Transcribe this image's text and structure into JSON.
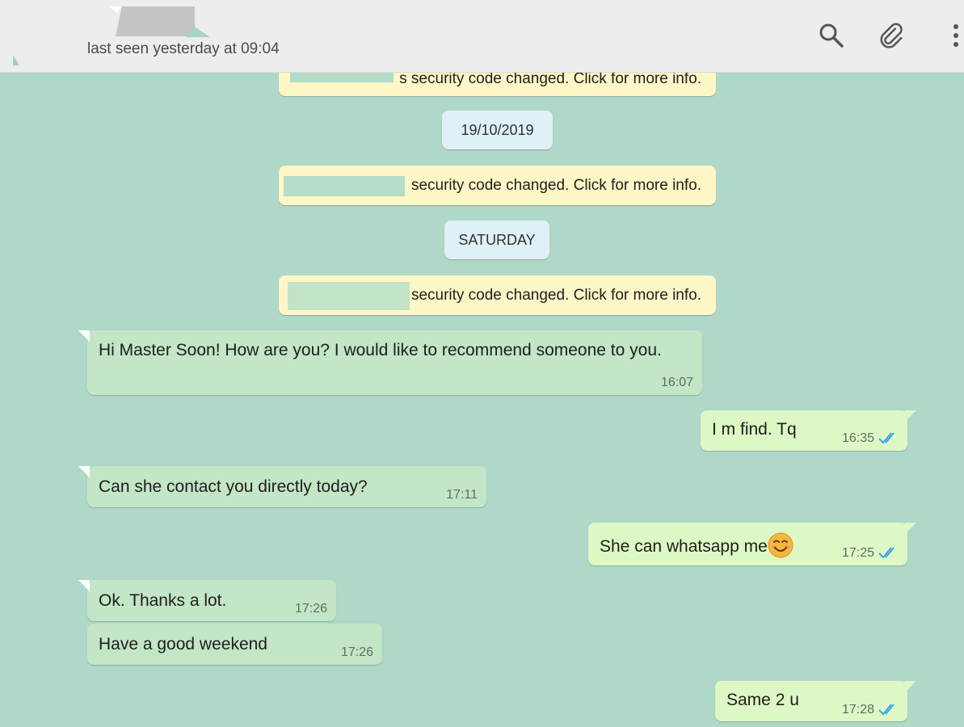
{
  "header": {
    "last_seen": "last seen yesterday at 09:04"
  },
  "messages": {
    "sys_top": "s security code changed. Click for more info.",
    "date_1": "19/10/2019",
    "sys_1": "security code changed. Click for more info.",
    "date_2": "SATURDAY",
    "sys_2": "security code changed. Click for more info.",
    "m1": {
      "text": "Hi Master Soon! How are you? I would like to recommend someone to you.",
      "time": "16:07"
    },
    "m2": {
      "text": "I m find. Tq",
      "time": "16:35"
    },
    "m3": {
      "text": "Can she contact you directly today?",
      "time": "17:11"
    },
    "m4": {
      "text": "She can whatsapp me",
      "time": "17:25"
    },
    "m5": {
      "text": "Ok. Thanks a lot.",
      "time": "17:26"
    },
    "m6": {
      "text": "Have a good weekend",
      "time": "17:26"
    },
    "m7": {
      "text": "Same 2 u",
      "time": "17:28"
    }
  },
  "colors": {
    "chat_bg": "#b0d8c8",
    "incoming": "#c2e6c6",
    "outgoing": "#ddf8c4",
    "system": "#fdf6c6",
    "date_chip": "#dff1f7",
    "read_ticks": "#3ba5e8"
  },
  "icons": [
    "search-icon",
    "attach-icon",
    "menu-icon",
    "smiling-face-emoji",
    "double-check-icon"
  ]
}
